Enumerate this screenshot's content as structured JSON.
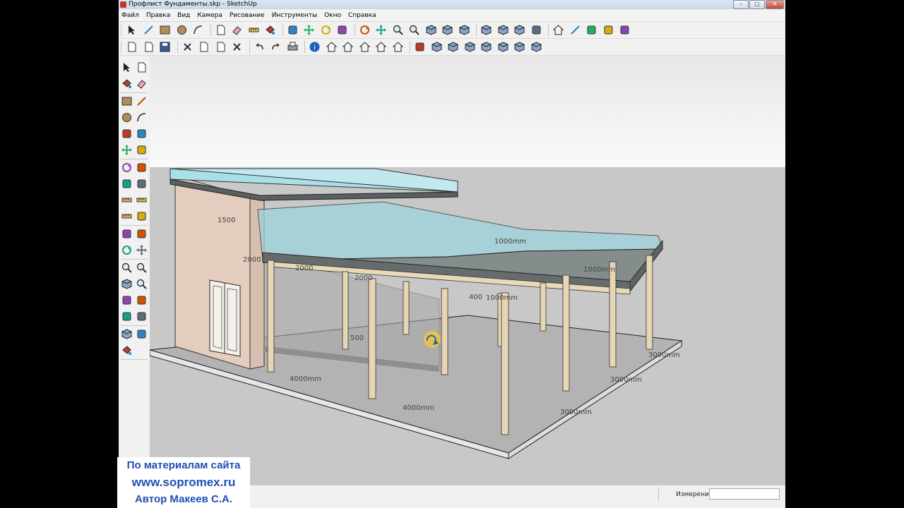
{
  "window": {
    "title": "Профлист Фундаменты.skp - SketchUp",
    "buttons": {
      "minimize": "–",
      "maximize": "□",
      "close": "✕"
    }
  },
  "menu": [
    "Файл",
    "Правка",
    "Вид",
    "Камера",
    "Рисование",
    "Инструменты",
    "Окно",
    "Справка"
  ],
  "toolbar_icons_row1": [
    "select-icon",
    "pencil-icon",
    "rectangle-icon",
    "circle-icon",
    "arc-icon",
    "make-component-icon",
    "eraser-icon",
    "tape-measure-icon",
    "paint-bucket-icon",
    "push-pull-icon",
    "move-icon",
    "rotate-icon",
    "follow-me-icon",
    "orbit-icon",
    "pan-icon",
    "zoom-icon",
    "zoom-extents-icon",
    "iso-view-icon",
    "top-view-icon",
    "front-view-icon",
    "right-view-icon",
    "back-view-icon",
    "left-view-icon",
    "xray-icon",
    "wireframe-icon",
    "hidden-line-icon",
    "shaded-icon",
    "textured-icon",
    "monochrome-icon"
  ],
  "toolbar_icons_row2": [
    "new-file-icon",
    "open-file-icon",
    "save-icon",
    "cut-icon",
    "copy-icon",
    "paste-icon",
    "delete-icon",
    "undo-icon",
    "redo-icon",
    "print-icon",
    "model-info-icon",
    "house-view-icon",
    "door-icon",
    "home-icon",
    "roof-icon",
    "frame-icon",
    "camera-icon",
    "standard-view-icon",
    "iso-box-icon",
    "top-box-icon",
    "front-box-icon",
    "right-box-icon",
    "back-box-icon",
    "left-box-icon"
  ],
  "left_tool_icons": [
    "select-icon",
    "component-icon",
    "paint-bucket-icon",
    "eraser-icon",
    "rectangle-icon",
    "line-icon",
    "circle-icon",
    "arc-icon",
    "polygon-icon",
    "freehand-icon",
    "move-icon",
    "push-pull-icon",
    "rotate-icon",
    "follow-me-icon",
    "scale-icon",
    "offset-icon",
    "tape-measure-icon",
    "dimension-icon",
    "protractor-icon",
    "text-icon",
    "axes-icon",
    "3d-text-icon",
    "orbit-icon",
    "pan-icon",
    "zoom-icon",
    "zoom-window-icon",
    "previous-view-icon",
    "zoom-extents-icon",
    "walk-icon",
    "look-around-icon",
    "position-camera-icon",
    "section-plane-icon",
    "sandbox-icon",
    "push-icon",
    "paint-icon"
  ],
  "model": {
    "dimensions": {
      "d1500": "1500",
      "d2000a": "2000",
      "d2000b": "2000",
      "d2000c": "2000",
      "d1000mm_top": "1000mm",
      "d1000mm_right": "1000mm",
      "d400": "400",
      "d100mm": "1000mm",
      "d4000mm_left": "4000mm",
      "d4000mm_front": "4000mm",
      "d3000mm_a": "3000mm",
      "d3000mm_b": "3000mm",
      "d3000mm_c": "3000mm",
      "d500": "500"
    }
  },
  "status": {
    "measurements_label": "Измерения",
    "measurements_value": ""
  },
  "watermark": {
    "line1": "По материалам сайта",
    "line2": "www.sopromex.ru",
    "line3": "Автор Макеев С.А."
  },
  "colors": {
    "glass": "#9ed3dc",
    "deck": "#7f8787",
    "post": "#e2d3b3",
    "ground": "#b5b5b5",
    "sky": "#f4f4f4"
  }
}
